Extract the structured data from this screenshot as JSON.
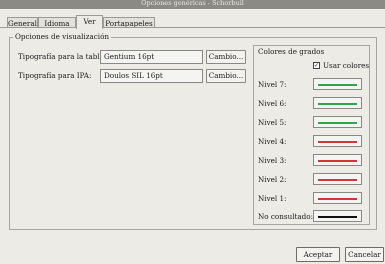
{
  "window": {
    "title": "Opciones genéricas - Schorbuil"
  },
  "tabs": [
    {
      "label": "General"
    },
    {
      "label": "Idioma"
    },
    {
      "label": "Ver"
    },
    {
      "label": "Portapapeles"
    }
  ],
  "panel": {
    "title": "Opciones de visualización",
    "table_font_label": "Tipografía para la tabla:",
    "table_font_value": "Gentium 16pt",
    "ipa_font_label": "Tipografía para IPA:",
    "ipa_font_value": "Doulos SIL 16pt",
    "change_button": "Cambio..."
  },
  "grades": {
    "title": "Colores de grados",
    "use_colors_label": "Usar colores",
    "use_colors_checked": true,
    "levels": [
      {
        "label": "Nivel 7:",
        "color": "#2ea64a"
      },
      {
        "label": "Nivel 6:",
        "color": "#2ea64a"
      },
      {
        "label": "Nivel 5:",
        "color": "#2ea64a"
      },
      {
        "label": "Nivel 4:",
        "color": "#d8343a"
      },
      {
        "label": "Nivel 3:",
        "color": "#d8343a"
      },
      {
        "label": "Nivel 2:",
        "color": "#d8343a"
      },
      {
        "label": "Nivel 1:",
        "color": "#d8343a"
      },
      {
        "label": "No consultado:",
        "color": "#111111"
      }
    ]
  },
  "footer": {
    "accept": "Aceptar",
    "cancel": "Cancelar"
  }
}
